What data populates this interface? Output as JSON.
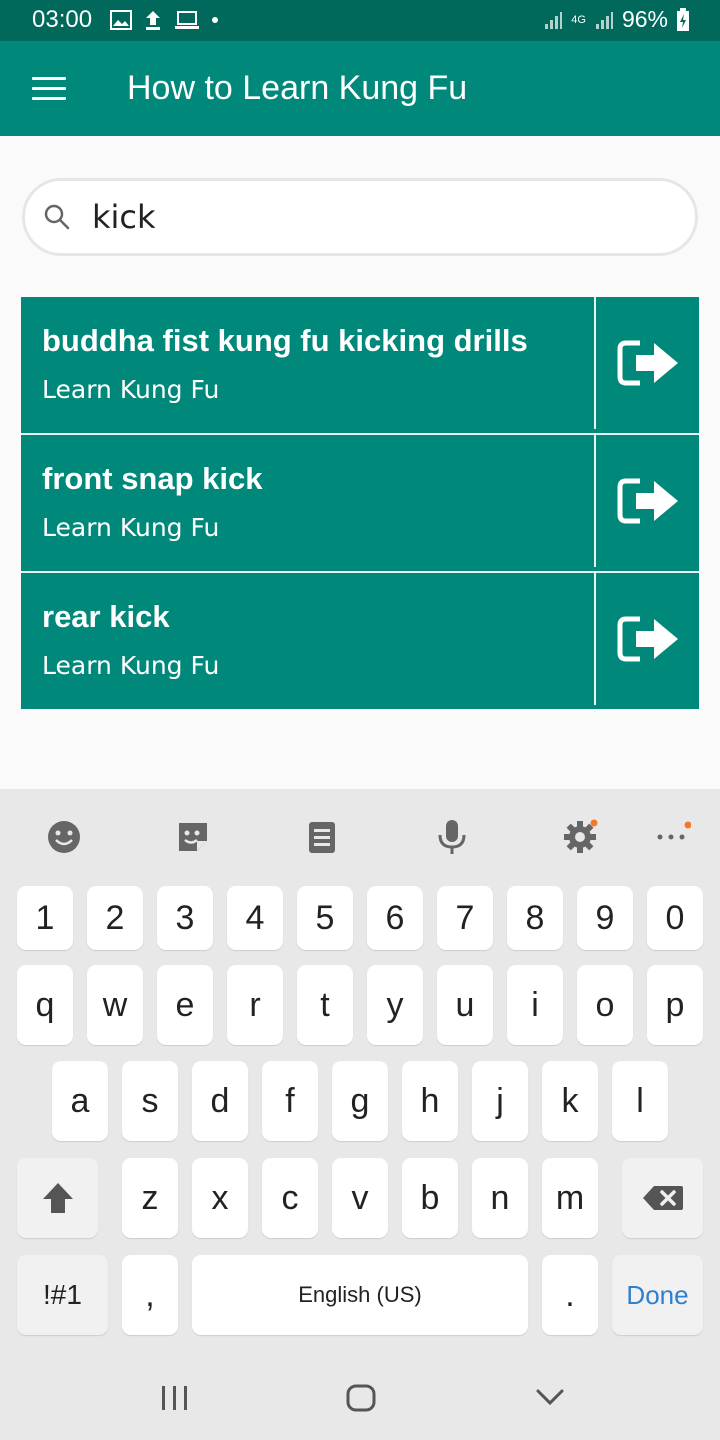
{
  "status_bar": {
    "time": "03:00",
    "network": "4G",
    "battery": "96%"
  },
  "app_bar": {
    "title": "How to Learn Kung Fu",
    "menu_icon": "hamburger-menu-icon"
  },
  "search": {
    "value": "kick",
    "icon": "search-icon"
  },
  "results": [
    {
      "title": "buddha fist kung fu kicking drills",
      "subtitle": "Learn Kung Fu"
    },
    {
      "title": "front snap kick",
      "subtitle": "Learn Kung Fu"
    },
    {
      "title": "rear kick",
      "subtitle": "Learn Kung Fu"
    }
  ],
  "keyboard": {
    "toolbar_icons": [
      "emoji-icon",
      "sticker-icon",
      "clipboard-icon",
      "microphone-icon",
      "settings-icon",
      "more-icon"
    ],
    "row_numbers": [
      "1",
      "2",
      "3",
      "4",
      "5",
      "6",
      "7",
      "8",
      "9",
      "0"
    ],
    "row_1": [
      "q",
      "w",
      "e",
      "r",
      "t",
      "y",
      "u",
      "i",
      "o",
      "p"
    ],
    "row_2": [
      "a",
      "s",
      "d",
      "f",
      "g",
      "h",
      "j",
      "k",
      "l"
    ],
    "row_3": [
      "z",
      "x",
      "c",
      "v",
      "b",
      "n",
      "m"
    ],
    "symbols_label": "!#1",
    "comma": ",",
    "space_label": "English (US)",
    "period": ".",
    "done_label": "Done"
  },
  "colors": {
    "status_bar": "#00695c",
    "app_bar": "#00897b",
    "done_key": "#2f7fd1"
  }
}
